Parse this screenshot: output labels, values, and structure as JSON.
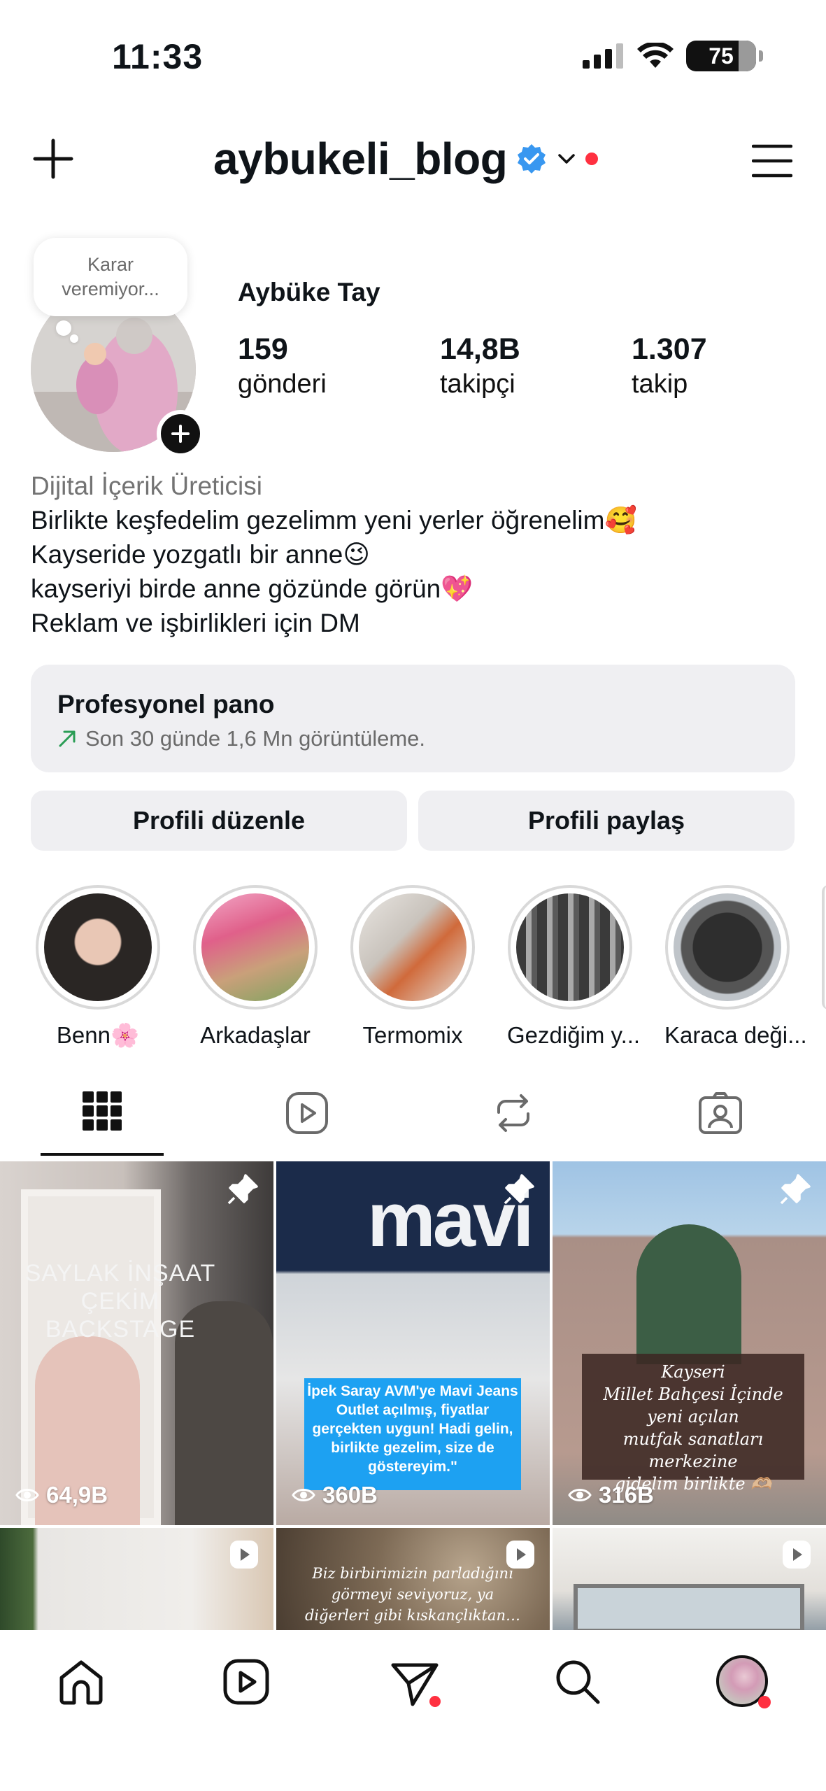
{
  "status_bar": {
    "time": "11:33",
    "battery": "75"
  },
  "header": {
    "username": "aybukeli_blog"
  },
  "profile": {
    "note": [
      "Karar",
      "veremiyor..."
    ],
    "display_name": "Aybüke Tay",
    "stats": [
      {
        "value": "159",
        "label": "gönderi"
      },
      {
        "value": "14,8B",
        "label": "takipçi"
      },
      {
        "value": "1.307",
        "label": "takip"
      }
    ],
    "category": "Dijital İçerik Üreticisi",
    "bio_lines": [
      "Birlikte keşfedelim gezelimm yeni yerler öğrenelim🥰",
      "Kayseride yozgatlı bir anne😉",
      "kayseriyi birde anne gözünde görün💖",
      "Reklam ve işbirlikleri için DM"
    ]
  },
  "dashboard": {
    "title": "Profesyonel pano",
    "subtitle": "Son 30 günde 1,6 Mn görüntüleme."
  },
  "buttons": {
    "edit": "Profili düzenle",
    "share": "Profili paylaş"
  },
  "highlights": [
    {
      "label": "Benn🌸"
    },
    {
      "label": "Arkadaşlar"
    },
    {
      "label": "Termomix"
    },
    {
      "label": "Gezdiğim y..."
    },
    {
      "label": "Karaca deği..."
    }
  ],
  "posts": [
    {
      "caption": "SAYLAK İNŞAAT\nÇEKİM BACKSTAGE",
      "views": "64,9B"
    },
    {
      "caption": "mavi",
      "overlay": "İpek Saray AVM'ye Mavi Jeans Outlet açılmış, fiyatlar gerçekten uygun! Hadi gelin, birlikte gezelim, size de göstereyim.\"",
      "views": "360B"
    },
    {
      "caption": "Kayseri\nMillet Bahçesi İçinde\nyeni açılan\nmutfak sanatları merkezine\ngidelim birlikte 🫶🏼",
      "views": "316B"
    },
    {
      "caption": "",
      "views": ""
    },
    {
      "caption": "Biz birbirimizin parladığını görmeyi seviyoruz, ya diğerleri gibi kıskançlıktan… ! ?",
      "views": ""
    },
    {
      "caption": "",
      "views": ""
    }
  ],
  "colors": {
    "accent_red": "#ff3040",
    "verified_blue": "#3897f0",
    "pano_green": "#2a9d55"
  }
}
